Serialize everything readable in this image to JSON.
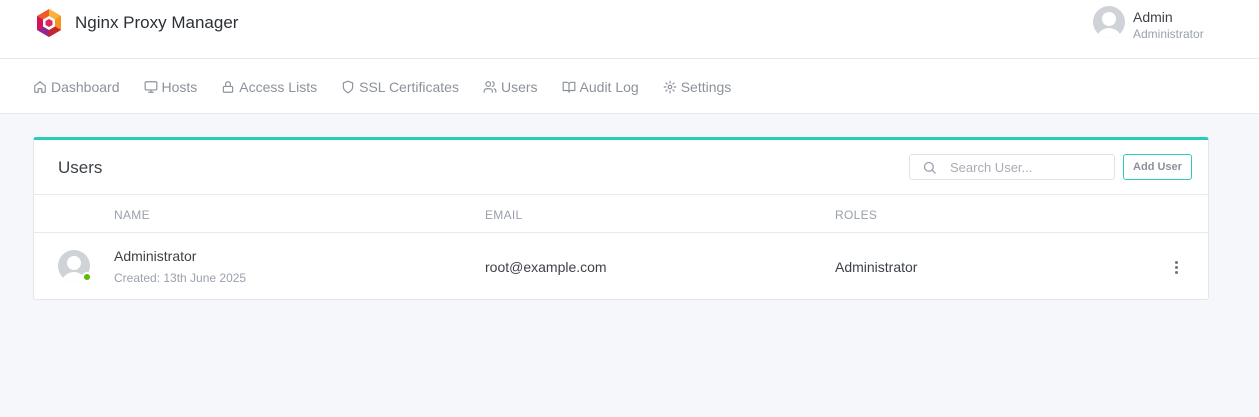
{
  "app": {
    "title": "Nginx Proxy Manager"
  },
  "user": {
    "name": "Admin",
    "role": "Administrator"
  },
  "nav": {
    "items": [
      {
        "label": "Dashboard",
        "icon": "home-icon"
      },
      {
        "label": "Hosts",
        "icon": "monitor-icon"
      },
      {
        "label": "Access Lists",
        "icon": "lock-icon"
      },
      {
        "label": "SSL Certificates",
        "icon": "shield-icon"
      },
      {
        "label": "Users",
        "icon": "users-icon"
      },
      {
        "label": "Audit Log",
        "icon": "book-open-icon"
      },
      {
        "label": "Settings",
        "icon": "settings-icon"
      }
    ]
  },
  "users_card": {
    "title": "Users",
    "search_placeholder": "Search User...",
    "add_label": "Add User",
    "columns": [
      "NAME",
      "EMAIL",
      "ROLES"
    ],
    "rows": [
      {
        "name": "Administrator",
        "created": "Created: 13th June 2025",
        "email": "root@example.com",
        "roles": "Administrator",
        "status": "online"
      }
    ]
  },
  "colors": {
    "accent": "#2bcbba",
    "status_online": "#5eba00"
  }
}
